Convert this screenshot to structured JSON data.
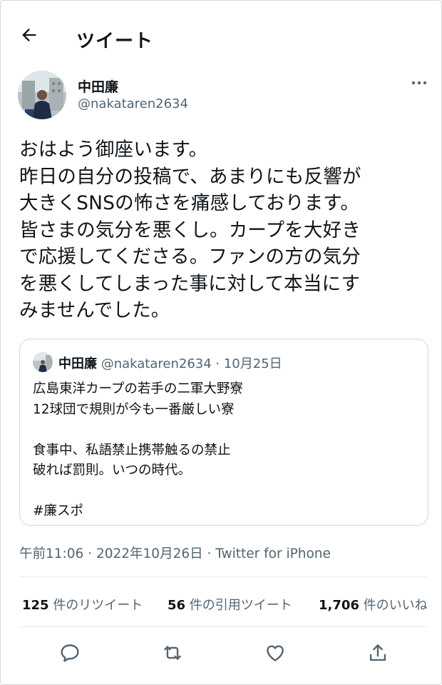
{
  "header": {
    "back_icon": "back-arrow-icon",
    "title": "ツイート"
  },
  "tweet": {
    "author_name": "中田廉",
    "author_handle": "@nakataren2634",
    "more_icon": "more-options-icon",
    "lines": [
      "おはよう御座います。",
      "昨日の自分の投稿で、あまりにも反響が",
      "大きくSNSの怖さを痛感しております。",
      "皆さまの気分を悪くし。カープを大好き",
      "で応援してくださる。ファンの方の気分",
      "を悪くしてしまった事に対して本当にす",
      "みませんでした。"
    ],
    "timestamp": "午前11:06 · 2022年10月26日 · Twitter for iPhone"
  },
  "quote": {
    "author_name": "中田廉",
    "meta": "@nakataren2634 · 10月25日",
    "lines": [
      "広島東洋カープの若手の二軍大野寮",
      "12球団で規則が今も一番厳しい寮",
      "",
      "食事中、私語禁止携帯触るの禁止",
      "破れば罰則。いつの時代。",
      "",
      "#廉スポ"
    ]
  },
  "stats": {
    "retweets_count": "125",
    "retweets_label": "件のリツイート",
    "quotes_count": "56",
    "quotes_label": "件の引用ツイート",
    "likes_count": "1,706",
    "likes_label": "件のいいね"
  },
  "actions": [
    "reply-icon",
    "retweet-icon",
    "like-icon",
    "share-icon"
  ],
  "colors": {
    "text": "#0f1419",
    "secondary": "#536471",
    "border": "#cfd9de"
  }
}
